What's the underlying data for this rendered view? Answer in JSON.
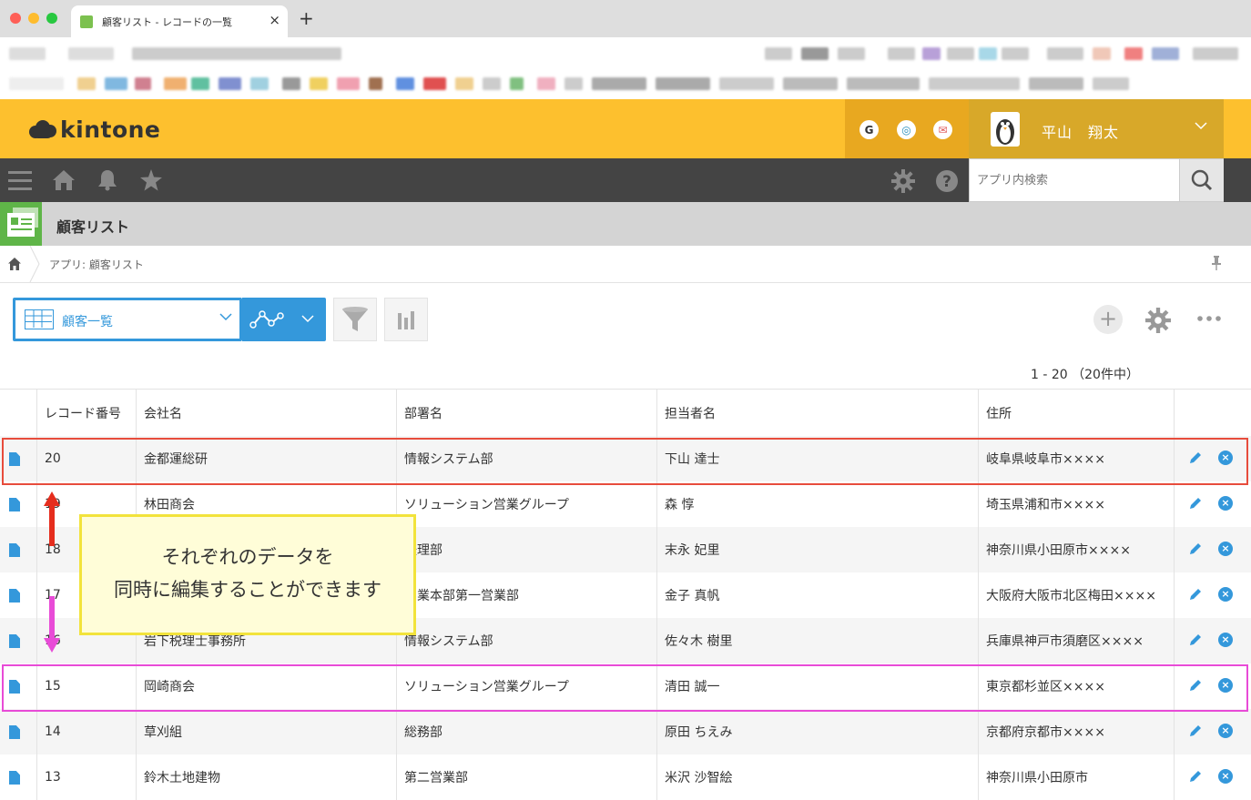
{
  "browser": {
    "tab_title": "顧客リスト - レコードの一覧",
    "new_tab": "+",
    "close": "×"
  },
  "header": {
    "logo_text": "kintone",
    "icons": [
      "G",
      "◎",
      "✉"
    ],
    "user_name": "平山　翔太"
  },
  "nav": {
    "search_placeholder": "アプリ内検索"
  },
  "app": {
    "title": "顧客リスト"
  },
  "breadcrumb": {
    "text": "アプリ: 顧客リスト"
  },
  "toolbar": {
    "view_label": "顧客一覧",
    "paging": "1 - 20 （20件中）"
  },
  "table": {
    "columns": [
      "レコード番号",
      "会社名",
      "部署名",
      "担当者名",
      "住所"
    ],
    "rows": [
      {
        "id": "20",
        "company": "金都運総研",
        "dept": "情報システム部",
        "person": "下山 達士",
        "address": "岐阜県岐阜市××××"
      },
      {
        "id": "19",
        "company": "林田商会",
        "dept": "ソリューション営業グループ",
        "person": "森 惇",
        "address": "埼玉県浦和市××××"
      },
      {
        "id": "18",
        "company": "",
        "dept": "経理部",
        "person": "末永 妃里",
        "address": "神奈川県小田原市××××"
      },
      {
        "id": "17",
        "company": "",
        "dept": "営業本部第一営業部",
        "person": "金子 真帆",
        "address": "大阪府大阪市北区梅田××××"
      },
      {
        "id": "16",
        "company": "岩下税理士事務所",
        "dept": "情報システム部",
        "person": "佐々木 樹里",
        "address": "兵庫県神戸市須磨区××××"
      },
      {
        "id": "15",
        "company": "岡崎商会",
        "dept": "ソリューション営業グループ",
        "person": "清田 誠一",
        "address": "東京都杉並区××××"
      },
      {
        "id": "14",
        "company": "草刈組",
        "dept": "総務部",
        "person": "原田 ちえみ",
        "address": "京都府京都市××××"
      },
      {
        "id": "13",
        "company": "鈴木土地建物",
        "dept": "第二営業部",
        "person": "米沢 沙智絵",
        "address": "神奈川県小田原市"
      }
    ]
  },
  "callout": {
    "line1": "それぞれのデータを",
    "line2": "同時に編集することができます"
  }
}
